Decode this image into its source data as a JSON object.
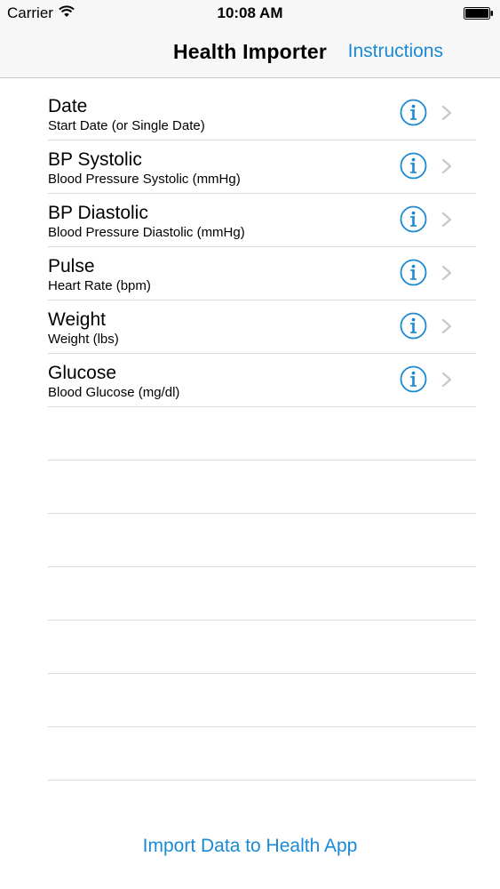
{
  "status_bar": {
    "carrier": "Carrier",
    "time": "10:08 AM",
    "wifi_icon": "wifi-icon",
    "battery_icon": "battery-icon"
  },
  "nav": {
    "title": "Health Importer",
    "instructions_label": "Instructions"
  },
  "rows": [
    {
      "title": "Date",
      "subtitle": "Start Date (or Single Date)"
    },
    {
      "title": "BP Systolic",
      "subtitle": "Blood Pressure Systolic (mmHg)"
    },
    {
      "title": "BP Diastolic",
      "subtitle": "Blood Pressure Diastolic (mmHg)"
    },
    {
      "title": "Pulse",
      "subtitle": "Heart Rate (bpm)"
    },
    {
      "title": "Weight",
      "subtitle": "Weight (lbs)"
    },
    {
      "title": "Glucose",
      "subtitle": "Blood Glucose (mg/dl)"
    }
  ],
  "row_icons": {
    "info": "info-icon",
    "chevron": "chevron-right-icon"
  },
  "footer": {
    "import_label": "Import Data to Health App"
  },
  "colors": {
    "accent": "#1a8ad4",
    "separator": "#dcdcdf",
    "bar_background": "#f7f7f7"
  }
}
